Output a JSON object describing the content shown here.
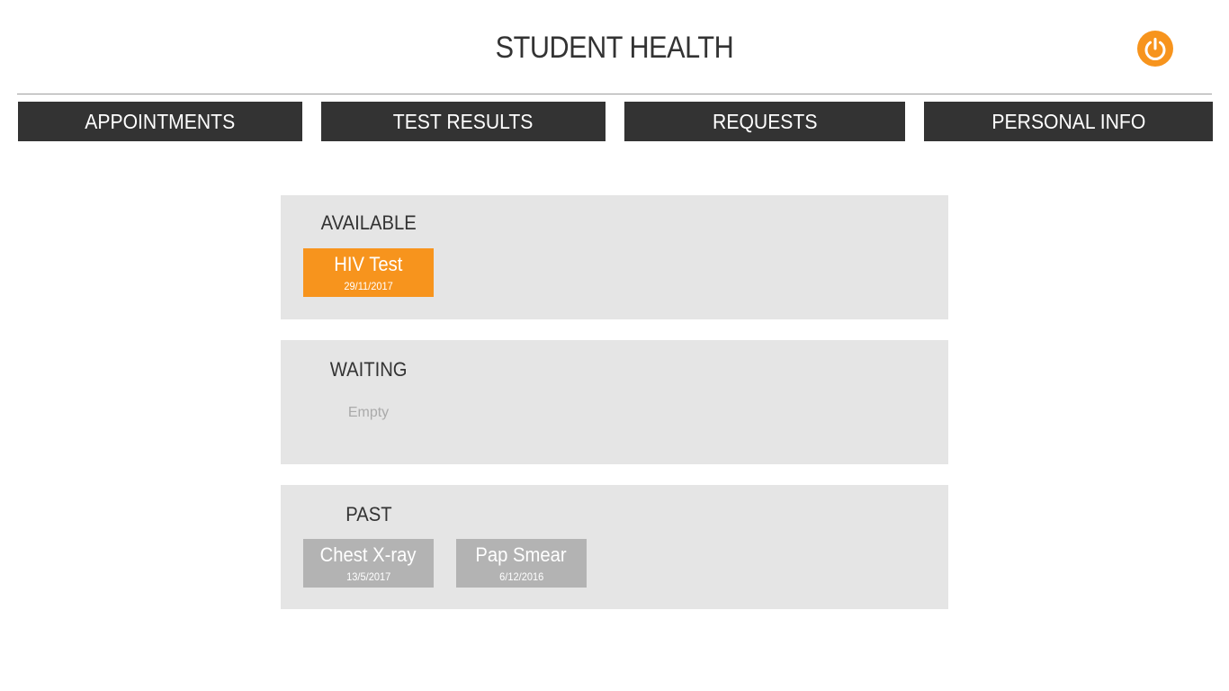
{
  "app": {
    "title": "STUDENT HEALTH"
  },
  "colors": {
    "accent": "#f7941d",
    "nav_bg": "#333333",
    "panel_bg": "#e5e5e5",
    "past_card_bg": "#b3b3b3"
  },
  "header": {
    "power_icon": "power-icon"
  },
  "nav": {
    "tabs": [
      {
        "label": "APPOINTMENTS"
      },
      {
        "label": "TEST RESULTS"
      },
      {
        "label": "REQUESTS"
      },
      {
        "label": "PERSONAL INFO"
      }
    ]
  },
  "sections": {
    "available": {
      "heading": "AVAILABLE",
      "items": [
        {
          "title": "HIV Test",
          "date": "29/11/2017"
        }
      ]
    },
    "waiting": {
      "heading": "WAITING",
      "empty_text": "Empty"
    },
    "past": {
      "heading": "PAST",
      "items": [
        {
          "title": "Chest X-ray",
          "date": "13/5/2017"
        },
        {
          "title": "Pap Smear",
          "date": "6/12/2016"
        }
      ]
    }
  }
}
